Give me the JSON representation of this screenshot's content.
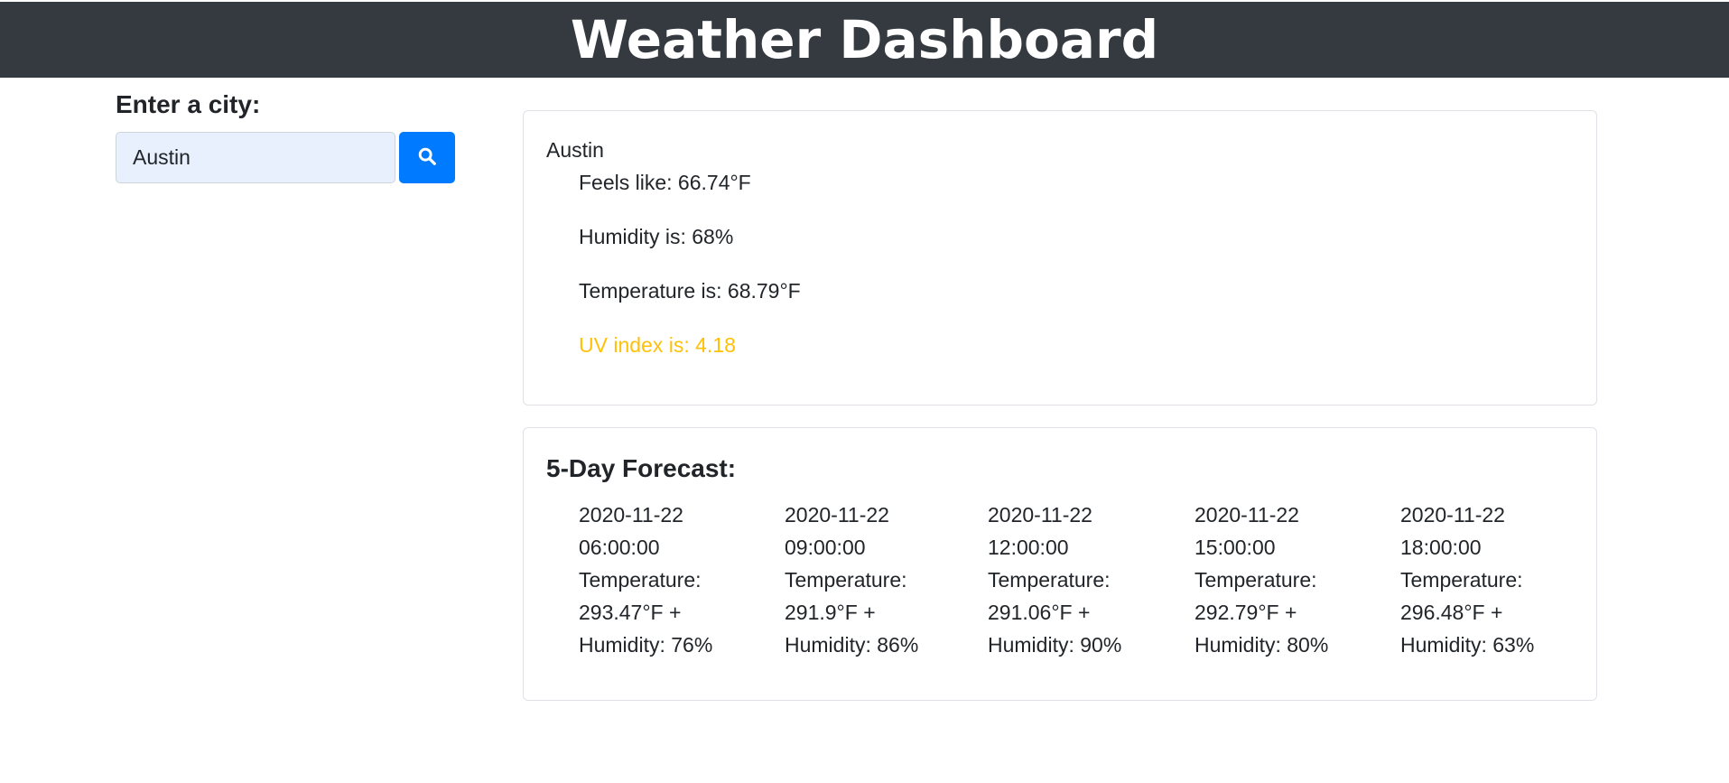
{
  "header": {
    "title": "Weather Dashboard"
  },
  "search": {
    "label": "Enter a city:",
    "value": "Austin",
    "button_icon": "search-icon",
    "button_color": "#007bff"
  },
  "current": {
    "city": "Austin",
    "feels_like": "Feels like: 66.74°F",
    "humidity": "Humidity is: 68%",
    "temperature": "Temperature is: 68.79°F",
    "uv_index": "UV index is: 4.18",
    "uv_color": "#ffc107"
  },
  "forecast": {
    "title": "5-Day Forecast:",
    "days": [
      {
        "date": "2020-11-22",
        "time": "06:00:00",
        "temp_label": "Temperature:",
        "temp": "293.47°F +",
        "humidity": "Humidity: 76%"
      },
      {
        "date": "2020-11-22",
        "time": "09:00:00",
        "temp_label": "Temperature:",
        "temp": "291.9°F +",
        "humidity": "Humidity: 86%"
      },
      {
        "date": "2020-11-22",
        "time": "12:00:00",
        "temp_label": "Temperature:",
        "temp": "291.06°F +",
        "humidity": "Humidity: 90%"
      },
      {
        "date": "2020-11-22",
        "time": "15:00:00",
        "temp_label": "Temperature:",
        "temp": "292.79°F +",
        "humidity": "Humidity: 80%"
      },
      {
        "date": "2020-11-22",
        "time": "18:00:00",
        "temp_label": "Temperature:",
        "temp": "296.48°F +",
        "humidity": "Humidity: 63%"
      }
    ]
  }
}
